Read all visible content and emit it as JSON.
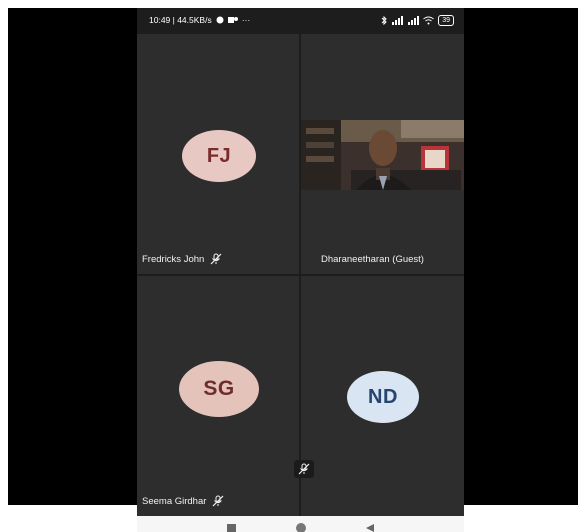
{
  "status_bar": {
    "time_speed": "10:49 | 44.5KB/s",
    "overflow": "···",
    "battery": "39"
  },
  "participants": [
    {
      "name": "Fredricks John",
      "initials": "FJ",
      "muted": true
    },
    {
      "name": "Dharaneetharan (Guest)",
      "initials": "",
      "muted": false,
      "video": true
    },
    {
      "name": "Seema Girdhar",
      "initials": "SG",
      "muted": true
    },
    {
      "name": "",
      "initials": "ND",
      "muted": true
    }
  ],
  "icons": {
    "mic_muted": "mic-off-icon",
    "nav_recent": "square-icon",
    "nav_home": "circle-icon",
    "nav_back": "triangle-back-icon"
  },
  "colors": {
    "tile_bg": "#2d2d2d",
    "fj_avatar": "#e8c8c3",
    "sg_avatar": "#e4c3bb",
    "nd_avatar": "#d9e5f2"
  }
}
